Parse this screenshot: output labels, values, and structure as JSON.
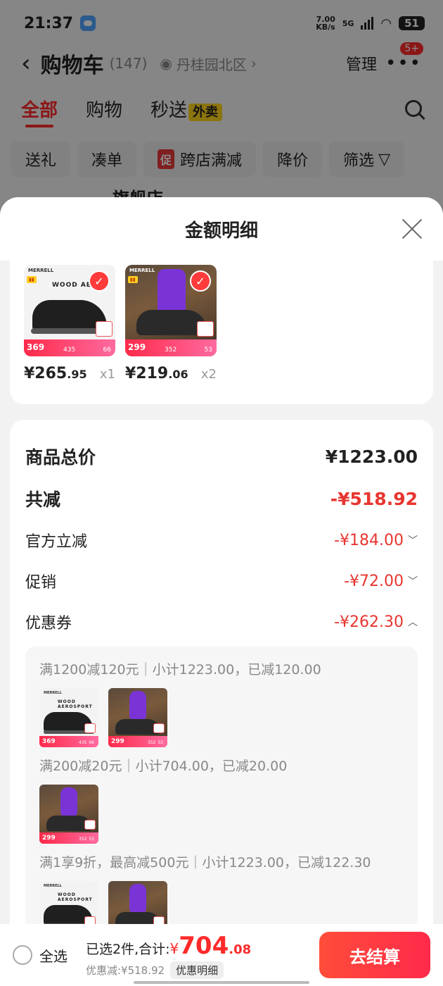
{
  "status_bar": {
    "time": "21:37",
    "net_speed_top": "7.00",
    "net_speed_bottom": "KB/s",
    "signal": "5G",
    "battery": "51"
  },
  "nav": {
    "title": "购物车",
    "count": "(147)",
    "location": "丹桂园北区",
    "manage": "管理",
    "more_badge": "5+"
  },
  "tabs": {
    "all": "全部",
    "shopping": "购物",
    "express": "秒送",
    "express_badge": "外卖"
  },
  "filters": {
    "gift": "送礼",
    "bundle": "凑单",
    "cu_tag": "促",
    "cross_store": "跨店满减",
    "price_drop": "降价",
    "filter": "筛选"
  },
  "background_store_partial": "旗舰店",
  "sheet": {
    "title": "金额明细",
    "products": [
      {
        "brand": "MERRELL",
        "model": "WOOD AEROS",
        "thumb_price": "369",
        "thumb_mid": "435",
        "thumb_r": "66",
        "price_int": "¥265",
        "price_dec": ".95",
        "qty": "x1"
      },
      {
        "brand": "MERRELL",
        "model": "",
        "thumb_price": "299",
        "thumb_mid": "352",
        "thumb_r": "53",
        "price_int": "¥219",
        "price_dec": ".06",
        "qty": "x2"
      }
    ],
    "summary": {
      "goods_total_label": "商品总价",
      "goods_total_value": "¥1223.00",
      "total_discount_label": "共减",
      "total_discount_value": "-¥518.92",
      "official_label": "官方立减",
      "official_value": "-¥184.00",
      "promo_label": "促销",
      "promo_value": "-¥72.00",
      "coupon_label": "优惠券",
      "coupon_value": "-¥262.30"
    },
    "coupons": [
      {
        "text": "满1200减120元｜小计1223.00，已减120.00"
      },
      {
        "text": "满200减20元｜小计704.00，已减20.00"
      },
      {
        "text": "满1享9折，最高减500元｜小计1223.00，已减122.30"
      }
    ],
    "small_thumbs": {
      "shoe_model": "WOOD AEROSPORT",
      "shoe_price": "369",
      "shoe_mid": "435",
      "shoe_r": "66",
      "sock_price": "299",
      "sock_mid": "352",
      "sock_r": "53"
    }
  },
  "bottom_bar": {
    "select_all": "全选",
    "selected_text": "已选2件,合计:",
    "currency": "¥",
    "amount_int": "704",
    "amount_dec": ".08",
    "discount_text": "优惠减:¥518.92",
    "detail_chip": "优惠明细",
    "checkout": "去结算"
  }
}
